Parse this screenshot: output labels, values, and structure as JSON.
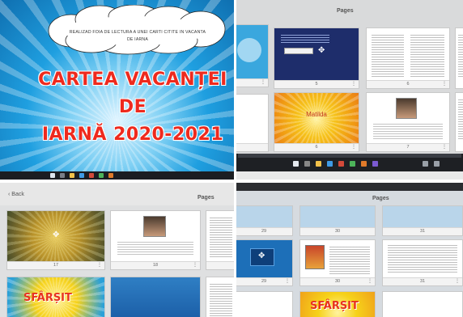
{
  "cover": {
    "cloud_text": "REALIZAD FOIA DE LECTURA A UNEI CARTI CITITE IN VACANTA DE IARNA",
    "title_line1": "CARTEA VACANȚEI DE",
    "title_line2": "IARNĂ 2020-2021"
  },
  "pages_panel_top": {
    "header": "Pages",
    "thumbnails": [
      {
        "number": "",
        "label": ""
      },
      {
        "number": "5",
        "label": ""
      },
      {
        "number": "6",
        "label": ""
      },
      {
        "number": "",
        "label": ""
      },
      {
        "number": "6",
        "label": "Matilda"
      },
      {
        "number": "7",
        "label": ""
      },
      {
        "number": "",
        "label": ""
      }
    ]
  },
  "pages_panel_bottom_left": {
    "back_label": "Back",
    "header": "Pages",
    "thumbnails": [
      {
        "number": "17"
      },
      {
        "number": "18"
      },
      {
        "number": ""
      },
      {
        "number": ""
      },
      {
        "number": ""
      }
    ],
    "sfarsit_text": "SFÂRȘIT"
  },
  "pages_panel_bottom_right": {
    "header": "Pages",
    "thumbnails": [
      {
        "number": "29"
      },
      {
        "number": "30"
      },
      {
        "number": "31"
      },
      {
        "number": "29"
      },
      {
        "number": "30"
      },
      {
        "number": "31"
      }
    ],
    "sfarsit_text": "SFÂRȘIT"
  },
  "colors": {
    "cover_blue": "#1f9ee0",
    "title_red": "#ee2a1e",
    "navy_slide": "#1e2d6b",
    "sun_yellow": "#f6c21a",
    "taskbar": "#1e2024"
  }
}
